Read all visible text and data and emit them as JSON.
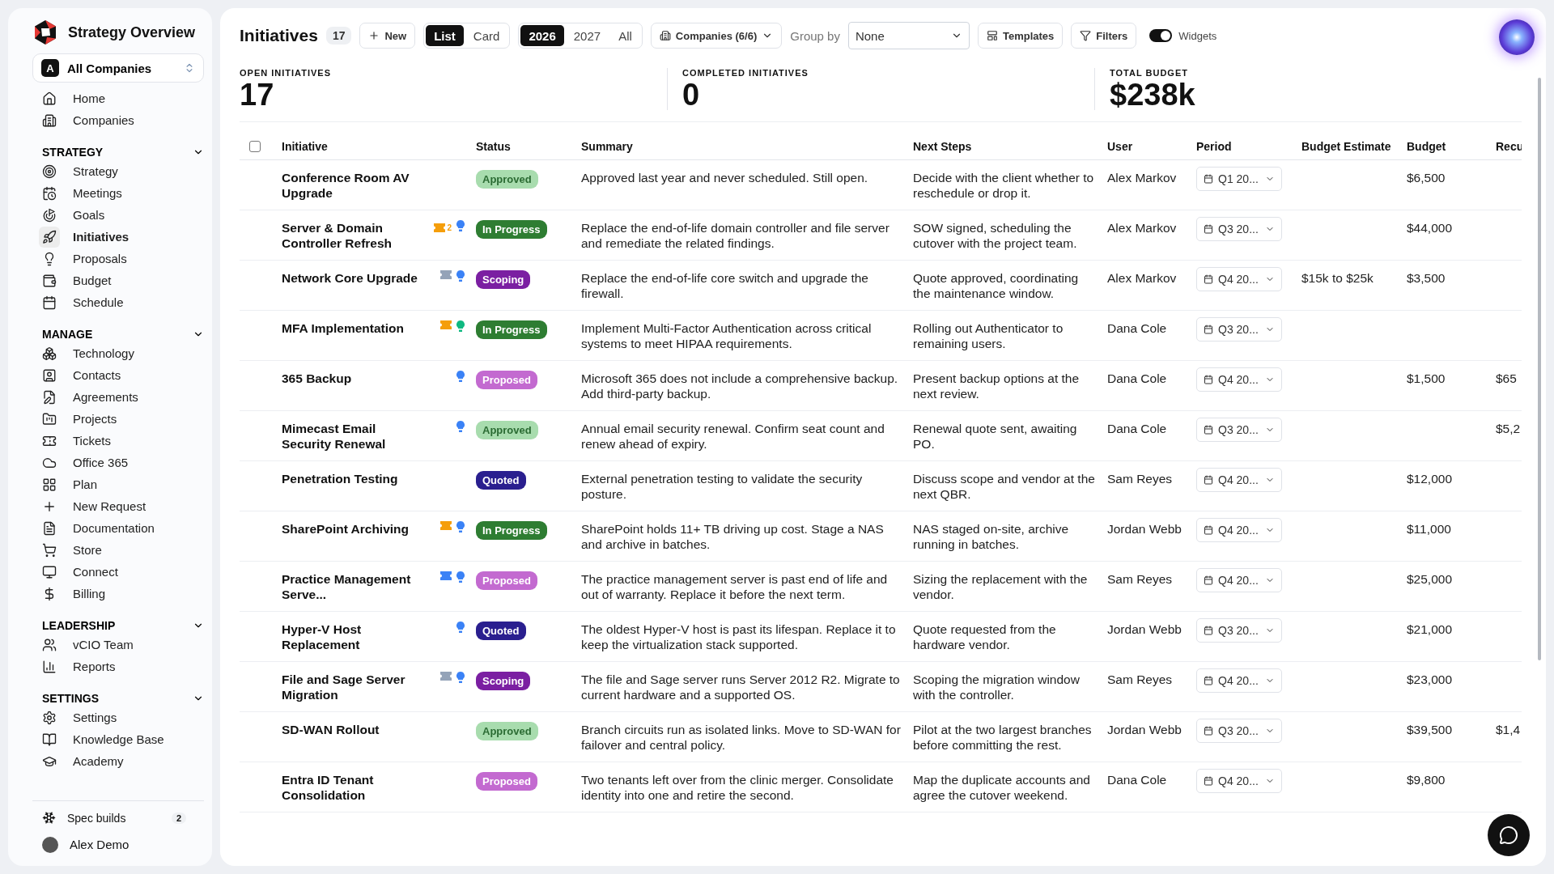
{
  "sidebar": {
    "app_title": "Strategy Overview",
    "company_switcher": {
      "badge": "A",
      "label": "All Companies"
    },
    "top_items": [
      {
        "label": "Home",
        "selected": false
      },
      {
        "label": "Companies",
        "selected": false
      }
    ],
    "sections": [
      {
        "title": "STRATEGY",
        "expanded": true,
        "items": [
          {
            "label": "Strategy",
            "selected": false
          },
          {
            "label": "Meetings",
            "selected": false
          },
          {
            "label": "Goals",
            "selected": false
          },
          {
            "label": "Initiatives",
            "selected": true
          },
          {
            "label": "Proposals",
            "selected": false
          },
          {
            "label": "Budget",
            "selected": false
          },
          {
            "label": "Schedule",
            "selected": false
          }
        ]
      },
      {
        "title": "MANAGE",
        "expanded": true,
        "items": [
          {
            "label": "Technology",
            "selected": false
          },
          {
            "label": "Contacts",
            "selected": false
          },
          {
            "label": "Agreements",
            "selected": false
          },
          {
            "label": "Projects",
            "selected": false
          },
          {
            "label": "Tickets",
            "selected": false
          },
          {
            "label": "Office 365",
            "selected": false
          },
          {
            "label": "Plan",
            "selected": false
          },
          {
            "label": "New Request",
            "selected": false
          },
          {
            "label": "Documentation",
            "selected": false
          },
          {
            "label": "Store",
            "selected": false
          },
          {
            "label": "Connect",
            "selected": false
          },
          {
            "label": "Billing",
            "selected": false
          }
        ]
      },
      {
        "title": "LEADERSHIP",
        "expanded": true,
        "items": [
          {
            "label": "vCIO Team",
            "selected": false
          },
          {
            "label": "Reports",
            "selected": false
          }
        ]
      },
      {
        "title": "SETTINGS",
        "expanded": true,
        "items": [
          {
            "label": "Settings",
            "selected": false
          },
          {
            "label": "Knowledge Base",
            "selected": false
          },
          {
            "label": "Academy",
            "selected": false
          }
        ]
      }
    ],
    "spec_builds": {
      "label": "Spec builds",
      "count": "2"
    },
    "user": {
      "name": "Alex Demo"
    }
  },
  "toolbar": {
    "title": "Initiatives",
    "count": "17",
    "new_button": "New",
    "views": [
      {
        "label": "List",
        "selected": true
      },
      {
        "label": "Card",
        "selected": false
      }
    ],
    "years": [
      {
        "label": "2026",
        "selected": true
      },
      {
        "label": "2027",
        "selected": false
      },
      {
        "label": "All",
        "selected": false
      }
    ],
    "companies_filter": "Companies (6/6)",
    "group_by": {
      "label": "Group by",
      "value": "None"
    },
    "templates_button": "Templates",
    "filters_button": "Filters",
    "widgets_toggle": {
      "label": "Widgets",
      "on": true
    }
  },
  "stats": [
    {
      "label": "OPEN INITIATIVES",
      "value": "17"
    },
    {
      "label": "COMPLETED INITIATIVES",
      "value": "0"
    },
    {
      "label": "TOTAL BUDGET",
      "value": "$238k"
    }
  ],
  "table": {
    "select_all": {
      "checked": false
    },
    "columns": [
      "Initiative",
      "Status",
      "Summary",
      "Next Steps",
      "User",
      "Period",
      "Budget Estimate",
      "Budget",
      "Recu"
    ],
    "rows": [
      {
        "initiative": "Conference Room AV Upgrade",
        "status": {
          "label": "Approved",
          "kind": "approved"
        },
        "summary": "Approved last year and never scheduled. Still open.",
        "next_steps": "Decide with the client whether to reschedule or drop it.",
        "user": "Alex Markov",
        "period": "Q1 20...",
        "budget": "$6,500"
      },
      {
        "initiative": "Server & Domain Controller Refresh",
        "ticket": {
          "color": "#f59e0b",
          "count": "2"
        },
        "idea": {
          "color": "#3b82f6"
        },
        "status": {
          "label": "In Progress",
          "kind": "in_progress"
        },
        "summary": "Replace the end-of-life domain controller and file server and remediate the related findings.",
        "next_steps": "SOW signed, scheduling the cutover with the project team.",
        "user": "Alex Markov",
        "period": "Q3 20...",
        "budget": "$44,000"
      },
      {
        "initiative": "Network Core Upgrade",
        "ticket": {
          "color": "#94a3b8"
        },
        "idea": {
          "color": "#3b82f6"
        },
        "status": {
          "label": "Scoping",
          "kind": "scoping"
        },
        "summary": "Replace the end-of-life core switch and upgrade the firewall.",
        "next_steps": "Quote approved, coordinating the maintenance window.",
        "user": "Alex Markov",
        "period": "Q4 20...",
        "estimate": "$15k to $25k",
        "budget": "$3,500"
      },
      {
        "initiative": "MFA Implementation",
        "ticket": {
          "color": "#f59e0b"
        },
        "idea": {
          "color": "#10b981"
        },
        "status": {
          "label": "In Progress",
          "kind": "in_progress"
        },
        "summary": "Implement Multi-Factor Authentication across critical systems to meet HIPAA requirements.",
        "next_steps": "Rolling out Authenticator to remaining users.",
        "user": "Dana Cole",
        "period": "Q3 20..."
      },
      {
        "initiative": "365 Backup",
        "idea": {
          "color": "#3b82f6"
        },
        "status": {
          "label": "Proposed",
          "kind": "proposed"
        },
        "summary": "Microsoft 365 does not include a comprehensive backup. Add third-party backup.",
        "next_steps": "Present backup options at the next review.",
        "user": "Dana Cole",
        "period": "Q4 20...",
        "budget": "$1,500",
        "recurring": "$65"
      },
      {
        "initiative": "Mimecast Email Security Renewal",
        "idea": {
          "color": "#3b82f6"
        },
        "status": {
          "label": "Approved",
          "kind": "approved"
        },
        "summary": "Annual email security renewal. Confirm seat count and renew ahead of expiry.",
        "next_steps": "Renewal quote sent, awaiting PO.",
        "user": "Dana Cole",
        "period": "Q3 20...",
        "recurring": "$5,2"
      },
      {
        "initiative": "Penetration Testing",
        "status": {
          "label": "Quoted",
          "kind": "quoted"
        },
        "summary": "External penetration testing to validate the security posture.",
        "next_steps": "Discuss scope and vendor at the next QBR.",
        "user": "Sam Reyes",
        "period": "Q4 20...",
        "budget": "$12,000"
      },
      {
        "initiative": "SharePoint Archiving",
        "ticket": {
          "color": "#f59e0b"
        },
        "idea": {
          "color": "#3b82f6"
        },
        "status": {
          "label": "In Progress",
          "kind": "in_progress"
        },
        "summary": "SharePoint holds 11+ TB driving up cost. Stage a NAS and archive in batches.",
        "next_steps": "NAS staged on-site, archive running in batches.",
        "user": "Jordan Webb",
        "period": "Q4 20...",
        "budget": "$11,000"
      },
      {
        "initiative": "Practice Management Serve...",
        "ticket": {
          "color": "#3b82f6"
        },
        "idea": {
          "color": "#3b82f6"
        },
        "status": {
          "label": "Proposed",
          "kind": "proposed"
        },
        "summary": "The practice management server is past end of life and out of warranty. Replace it before the next term.",
        "next_steps": "Sizing the replacement with the vendor.",
        "user": "Sam Reyes",
        "period": "Q4 20...",
        "budget": "$25,000"
      },
      {
        "initiative": "Hyper-V Host Replacement",
        "idea": {
          "color": "#3b82f6"
        },
        "status": {
          "label": "Quoted",
          "kind": "quoted"
        },
        "summary": "The oldest Hyper-V host is past its lifespan. Replace it to keep the virtualization stack supported.",
        "next_steps": "Quote requested from the hardware vendor.",
        "user": "Jordan Webb",
        "period": "Q3 20...",
        "budget": "$21,000"
      },
      {
        "initiative": "File and Sage Server Migration",
        "ticket": {
          "color": "#94a3b8"
        },
        "idea": {
          "color": "#3b82f6"
        },
        "status": {
          "label": "Scoping",
          "kind": "scoping"
        },
        "summary": "The file and Sage server runs Server 2012 R2. Migrate to current hardware and a supported OS.",
        "next_steps": "Scoping the migration window with the controller.",
        "user": "Sam Reyes",
        "period": "Q4 20...",
        "budget": "$23,000"
      },
      {
        "initiative": "SD-WAN Rollout",
        "status": {
          "label": "Approved",
          "kind": "approved"
        },
        "summary": "Branch circuits run as isolated links. Move to SD-WAN for failover and central policy.",
        "next_steps": "Pilot at the two largest branches before committing the rest.",
        "user": "Jordan Webb",
        "period": "Q3 20...",
        "budget": "$39,500",
        "recurring": "$1,4"
      },
      {
        "initiative": "Entra ID Tenant Consolidation",
        "status": {
          "label": "Proposed",
          "kind": "proposed"
        },
        "summary": "Two tenants left over from the clinic merger. Consolidate identity into one and retire the second.",
        "next_steps": "Map the duplicate accounts and agree the cutover weekend.",
        "user": "Dana Cole",
        "period": "Q4 20...",
        "budget": "$9,800"
      }
    ]
  }
}
